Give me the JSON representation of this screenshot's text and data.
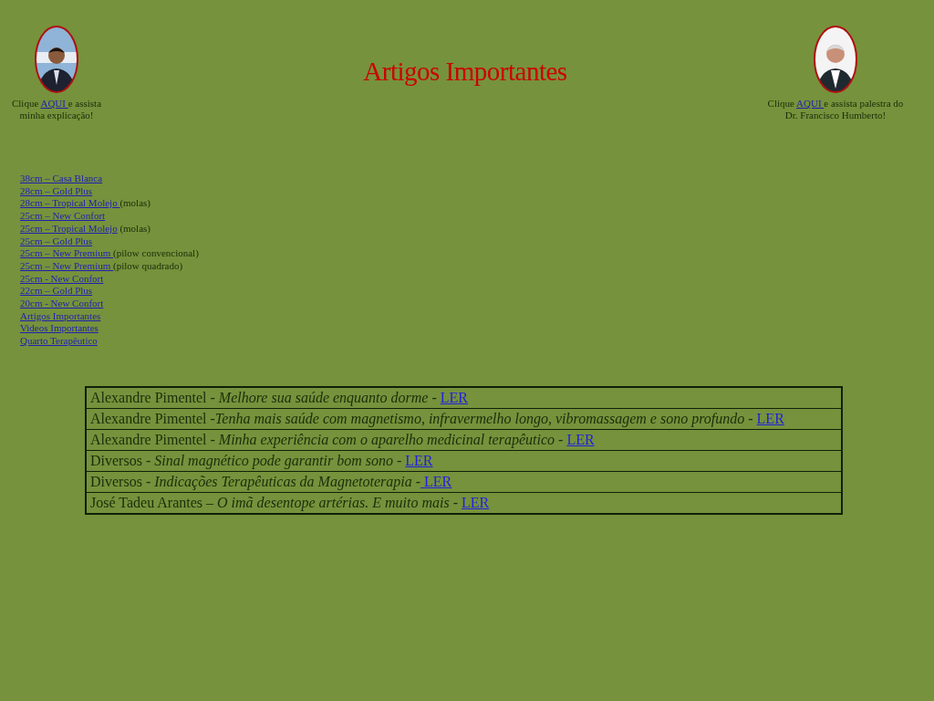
{
  "header": {
    "title": "Artigos Importantes",
    "left": {
      "before": "Clique ",
      "link": "AQUI ",
      "after": "e assista minha explicação!"
    },
    "right": {
      "before": "Clique ",
      "link": "AQUI ",
      "after": "e assista palestra do Dr. Francisco Humberto!"
    }
  },
  "nav": [
    {
      "link": "38cm – Casa Blanca"
    },
    {
      "link": "28cm – Gold Plus"
    },
    {
      "link": "28cm – Tropical Molejo ",
      "note": "(molas)"
    },
    {
      "link": "25cm – New Confort"
    },
    {
      "link": "25cm – Tropical Molejo",
      "note": " (molas)"
    },
    {
      "link": "25cm – Gold Plus"
    },
    {
      "link": "25cm – New Premium ",
      "note": "(pilow convencional)"
    },
    {
      "link": "25cm – New Premium ",
      "note": "(pilow quadrado)"
    },
    {
      "link": "25cm - New Confort"
    },
    {
      "link": "22cm – Gold Plus"
    },
    {
      "link": "20cm - New Confort"
    },
    {
      "link": "Artigos Importantes"
    },
    {
      "link": "Videos  Importantes"
    },
    {
      "link": "Quarto Terapêutico"
    }
  ],
  "articles": [
    {
      "text": "Alexandre Pimentel - *Melhore sua saúde enquanto dorme* -  ",
      "link": "LER"
    },
    {
      "text": "Alexandre Pimentel -*Tenha mais saúde com magnetismo, infravermelho longo, vibromassagem e sono profundo* - ",
      "link": "LER"
    },
    {
      "text": "Alexandre Pimentel - *Minha experiência com o aparelho medicinal terapêutico* - ",
      "link": "LER"
    },
    {
      "text": "Diversos - *Sinal magnético pode garantir bom sono* - ",
      "link": "LER"
    },
    {
      "text": "Diversos - *Indicações Terapêuticas da Magnetoterapia* -",
      "link": " LER"
    },
    {
      "text": "José Tadeu Arantes – *O imã desentope artérias. E muito mais* - ",
      "link": "LER"
    }
  ]
}
